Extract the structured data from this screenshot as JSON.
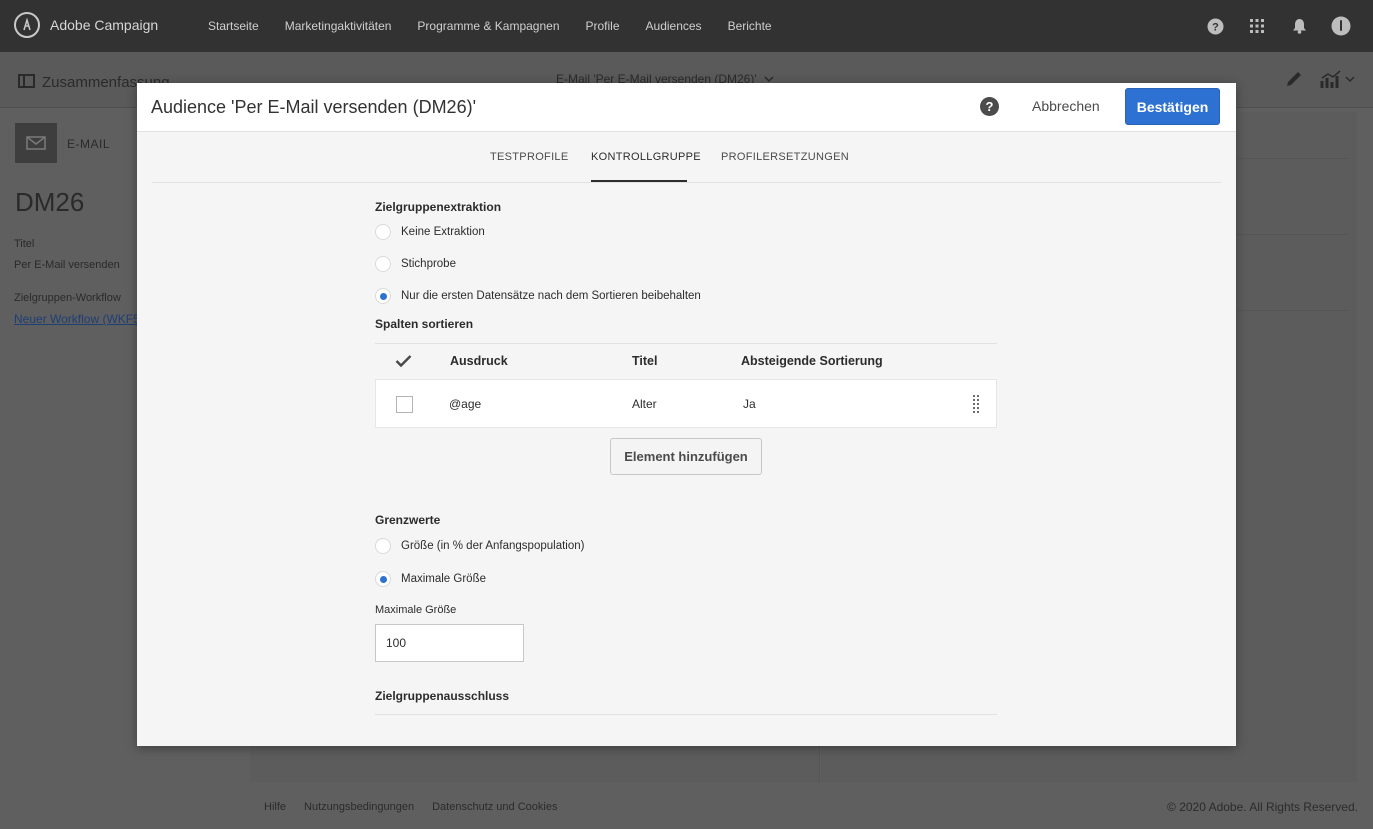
{
  "topbar": {
    "brand": "Adobe Campaign",
    "nav": [
      "Startseite",
      "Marketingaktivitäten",
      "Programme & Kampagnen",
      "Profile",
      "Audiences",
      "Berichte"
    ],
    "icons": [
      "help-icon",
      "apps-grid-icon",
      "bell-icon",
      "avatar-icon"
    ]
  },
  "subbar": {
    "summary": "Zusammenfassung",
    "center": "E-Mail 'Per E-Mail versenden (DM26)'"
  },
  "left_panel": {
    "channel": "E-MAIL",
    "code": "DM26",
    "title_label": "Titel",
    "title_value": "Per E-Mail versenden",
    "workflow_label": "Zielgruppen-Workflow",
    "workflow_link": "Neuer Workflow (WKF5"
  },
  "footer": {
    "links": [
      "Hilfe",
      "Nutzungsbedingungen",
      "Datenschutz und Cookies"
    ],
    "copyright": "© 2020 Adobe. All Rights Reserved."
  },
  "modal": {
    "title": "Audience 'Per E-Mail versenden (DM26)'",
    "help": "?",
    "cancel": "Abbrechen",
    "confirm": "Bestätigen",
    "tabs": [
      "TESTPROFILE",
      "KONTROLLGRUPPE",
      "PROFILERSETZUNGEN"
    ],
    "active_tab": "KONTROLLGRUPPE",
    "extraction": {
      "title": "Zielgruppenextraktion",
      "options": [
        "Keine Extraktion",
        "Stichprobe",
        "Nur die ersten Datensätze nach dem Sortieren beibehalten"
      ],
      "selected": 2
    },
    "sort": {
      "title": "Spalten sortieren",
      "columns": [
        "Ausdruck",
        "Titel",
        "Absteigende Sortierung"
      ],
      "rows": [
        {
          "expression": "@age",
          "title": "Alter",
          "descending": "Ja"
        }
      ],
      "add_button": "Element hinzufügen"
    },
    "limits": {
      "title": "Grenzwerte",
      "options": [
        "Größe (in % der Anfangspopulation)",
        "Maximale Größe"
      ],
      "selected": 1,
      "field_label": "Maximale Größe",
      "field_value": "100"
    },
    "exclusion_title": "Zielgruppenausschluss"
  }
}
